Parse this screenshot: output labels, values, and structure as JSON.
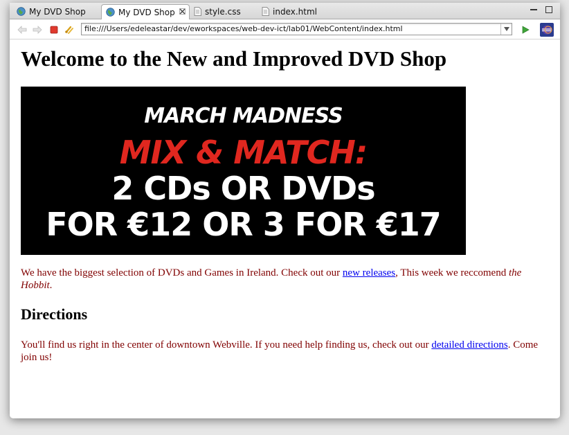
{
  "tabs": [
    {
      "label": "My DVD Shop",
      "icon": "globe-icon",
      "active": false
    },
    {
      "label": "My DVD Shop",
      "icon": "globe-icon",
      "active": true
    },
    {
      "label": "style.css",
      "icon": "document-icon",
      "active": false
    },
    {
      "label": "index.html",
      "icon": "document-icon",
      "active": false
    }
  ],
  "toolbar": {
    "url": "file:///Users/edeleastar/dev/eworkspaces/web-dev-ict/lab01/WebContent/index.html"
  },
  "page": {
    "heading": "Welcome to the New and Improved DVD Shop",
    "banner": {
      "line1": "MARCH MADNESS",
      "line2": "MIX & MATCH:",
      "line3": "2 CDs OR DVDs",
      "line4": "FOR €12 OR 3 FOR €17"
    },
    "intro": {
      "text_before": "We have the biggest selection of DVDs and Games in Ireland. Check out our ",
      "link": "new releases",
      "text_after": ", This week we reccomend ",
      "emphasis": "the Hobbit",
      "end": "."
    },
    "directions_heading": "Directions",
    "directions": {
      "text_before": "You'll find us right in the center of downtown Webville. If you need help finding us, check out our ",
      "link": "detailed directions",
      "text_after": ". Come join us!"
    }
  },
  "colors": {
    "paragraph_text": "#800000",
    "link": "#0000ee",
    "banner_red": "#e0271f",
    "banner_bg": "#000000"
  }
}
